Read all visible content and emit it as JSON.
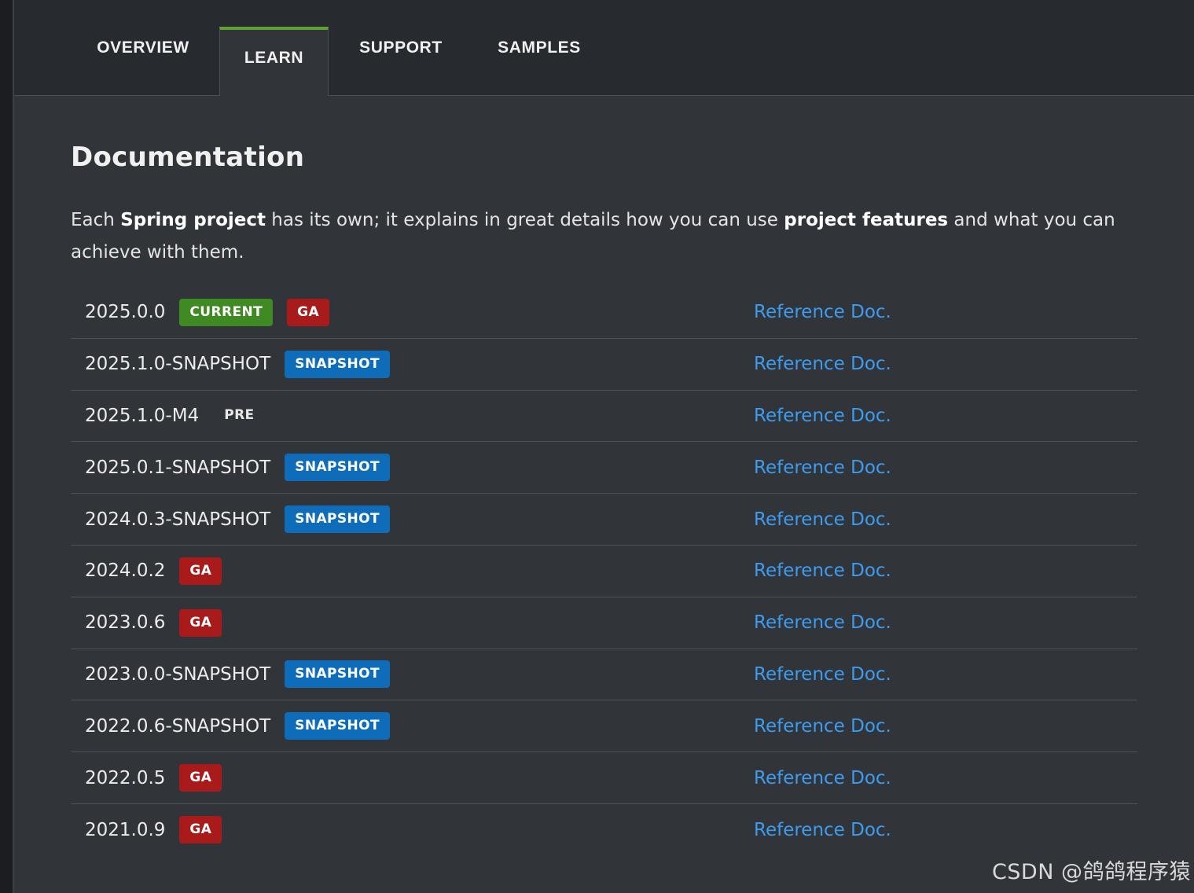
{
  "tabs": {
    "overview": "OVERVIEW",
    "learn": "LEARN",
    "support": "SUPPORT",
    "samples": "SAMPLES",
    "active": "LEARN",
    "active_color": "#5fa134"
  },
  "documentation": {
    "title": "Documentation",
    "description": {
      "part1": "Each ",
      "bold1": "Spring project",
      "part2": " has its own; it explains in great details how you can use ",
      "bold2": "project features",
      "part3": " and what you can achieve with them."
    }
  },
  "versions": [
    {
      "version": "2025.0.0",
      "badges": [
        {
          "label": "CURRENT",
          "type": "current"
        },
        {
          "label": "GA",
          "type": "ga"
        }
      ],
      "link": "Reference Doc."
    },
    {
      "version": "2025.1.0-SNAPSHOT",
      "badges": [
        {
          "label": "SNAPSHOT",
          "type": "snapshot"
        }
      ],
      "link": "Reference Doc."
    },
    {
      "version": "2025.1.0-M4",
      "badges": [
        {
          "label": "PRE",
          "type": "pre"
        }
      ],
      "link": "Reference Doc."
    },
    {
      "version": "2025.0.1-SNAPSHOT",
      "badges": [
        {
          "label": "SNAPSHOT",
          "type": "snapshot"
        }
      ],
      "link": "Reference Doc."
    },
    {
      "version": "2024.0.3-SNAPSHOT",
      "badges": [
        {
          "label": "SNAPSHOT",
          "type": "snapshot"
        }
      ],
      "link": "Reference Doc."
    },
    {
      "version": "2024.0.2",
      "badges": [
        {
          "label": "GA",
          "type": "ga"
        }
      ],
      "link": "Reference Doc."
    },
    {
      "version": "2023.0.6",
      "badges": [
        {
          "label": "GA",
          "type": "ga"
        }
      ],
      "link": "Reference Doc."
    },
    {
      "version": "2023.0.0-SNAPSHOT",
      "badges": [
        {
          "label": "SNAPSHOT",
          "type": "snapshot"
        }
      ],
      "link": "Reference Doc."
    },
    {
      "version": "2022.0.6-SNAPSHOT",
      "badges": [
        {
          "label": "SNAPSHOT",
          "type": "snapshot"
        }
      ],
      "link": "Reference Doc."
    },
    {
      "version": "2022.0.5",
      "badges": [
        {
          "label": "GA",
          "type": "ga"
        }
      ],
      "link": "Reference Doc."
    },
    {
      "version": "2021.0.9",
      "badges": [
        {
          "label": "GA",
          "type": "ga"
        }
      ],
      "link": "Reference Doc."
    }
  ],
  "badge_colors": {
    "current": "#3f8a22",
    "ga": "#a91b1b",
    "snapshot": "#0e6cb8"
  },
  "link_color": "#3d9cf0",
  "watermark": "CSDN @鸽鸽程序猿"
}
